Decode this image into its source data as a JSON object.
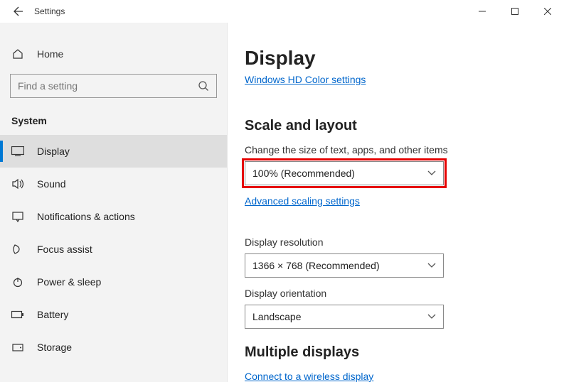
{
  "titlebar": {
    "title": "Settings"
  },
  "sidebar": {
    "home_label": "Home",
    "search_placeholder": "Find a setting",
    "category_label": "System",
    "items": [
      {
        "label": "Display"
      },
      {
        "label": "Sound"
      },
      {
        "label": "Notifications & actions"
      },
      {
        "label": "Focus assist"
      },
      {
        "label": "Power & sleep"
      },
      {
        "label": "Battery"
      },
      {
        "label": "Storage"
      }
    ]
  },
  "main": {
    "page_title": "Display",
    "hd_link": "Windows HD Color settings",
    "section_scale": "Scale and layout",
    "scale_label": "Change the size of text, apps, and other items",
    "scale_value": "100% (Recommended)",
    "adv_scaling_link": "Advanced scaling settings",
    "resolution_label": "Display resolution",
    "resolution_value": "1366 × 768 (Recommended)",
    "orientation_label": "Display orientation",
    "orientation_value": "Landscape",
    "section_multi": "Multiple displays",
    "wireless_link": "Connect to a wireless display"
  }
}
